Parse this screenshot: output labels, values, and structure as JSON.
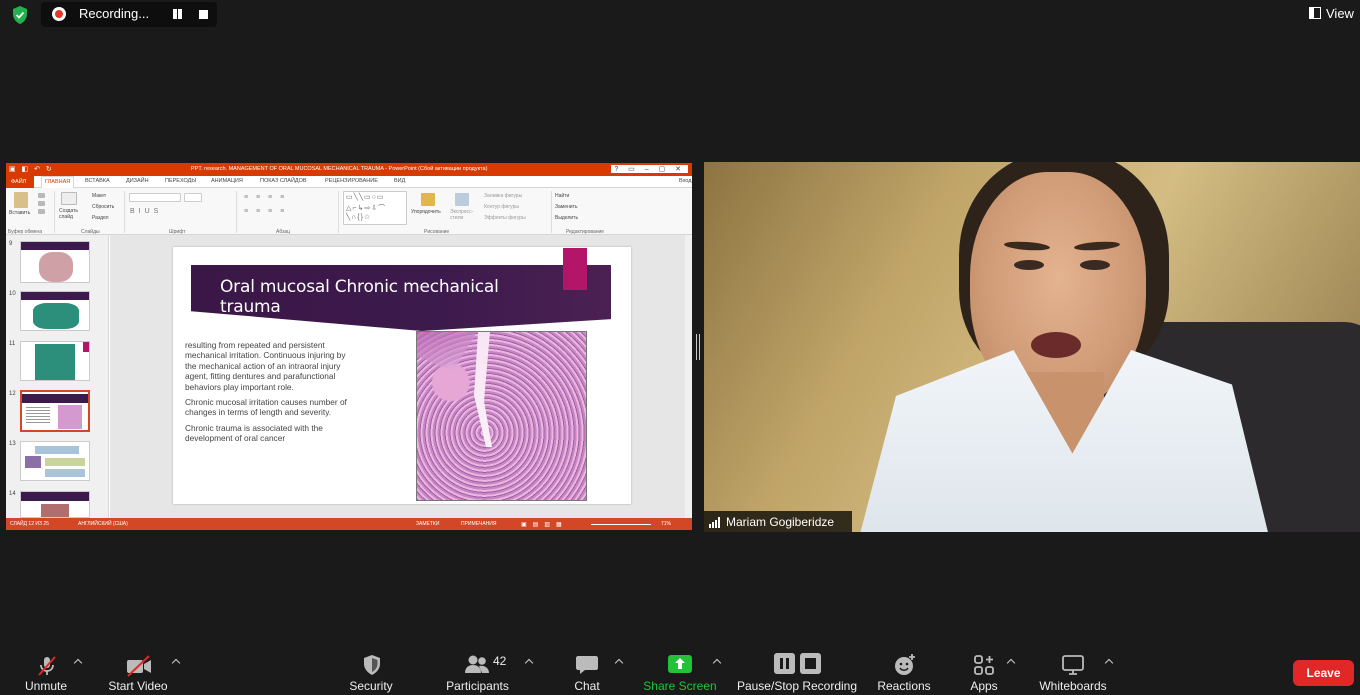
{
  "top_bar": {
    "recording_label": "Recording...",
    "view_label": "View"
  },
  "powerpoint": {
    "title_doc": "PPT. research. MANAGEMENT OF ORAL MUCOSAL MECHANICAL TRAUMA - PowerPoint (Сбой активации продукта)",
    "sign_in": "Вход",
    "tabs": [
      "ФАЙЛ",
      "ГЛАВНАЯ",
      "ВСТАВКА",
      "ДИЗАЙН",
      "ПЕРЕХОДЫ",
      "АНИМАЦИЯ",
      "ПОКАЗ СЛАЙДОВ",
      "РЕЦЕНЗИРОВАНИЕ",
      "ВИД"
    ],
    "ribbon": {
      "paste": "Вставить",
      "new_slide": "Создать слайд",
      "layout": "Макет",
      "reset": "Сбросить",
      "section": "Раздел",
      "arrange": "Упорядочить",
      "quick_styles": "Экспресс-стили",
      "shape_fill": "Заливка фигуры",
      "shape_outline": "Контур фигуры",
      "shape_effects": "Эффекты фигуры",
      "find": "Найти",
      "replace": "Заменить",
      "select": "Выделить",
      "group_clipboard": "Буфер обмена",
      "group_slides": "Слайды",
      "group_font": "Шрифт",
      "group_paragraph": "Абзац",
      "group_drawing": "Рисование",
      "group_editing": "Редактирование"
    },
    "thumbnails": [
      "9",
      "10",
      "11",
      "12",
      "13",
      "14"
    ],
    "selected_thumbnail": "12",
    "slide": {
      "title": "Oral mucosal Chronic mechanical trauma",
      "paragraphs": [
        " resulting from repeated and persistent mechanical irritation. Continuous injuring by the mechanical action of an intraoral injury agent, fitting dentures and parafunctional behaviors play important role.",
        "Chronic mucosal irritation causes number of changes in terms of length and severity.",
        "Chronic trauma is associated with the development of oral cancer"
      ]
    },
    "status": {
      "slide_info": "СЛАЙД 12 ИЗ 25",
      "language": "АНГЛИЙСКИЙ (США)",
      "notes": "ЗАМЕТКИ",
      "comments": "ПРИМЕЧАНИЯ",
      "zoom": "71%"
    }
  },
  "video": {
    "participant_name": "Mariam Gogiberidze"
  },
  "toolbar": {
    "unmute": "Unmute",
    "start_video": "Start Video",
    "security": "Security",
    "participants": "Participants",
    "participants_count": "42",
    "chat": "Chat",
    "share_screen": "Share Screen",
    "pause_stop_recording": "Pause/Stop Recording",
    "reactions": "Reactions",
    "apps": "Apps",
    "whiteboards": "Whiteboards",
    "leave": "Leave"
  },
  "colors": {
    "share_green": "#22c33a",
    "leave_red": "#e02828",
    "ppt_orange": "#d83b01",
    "slide_purple": "#3d1a4d",
    "slide_magenta": "#b31669"
  }
}
